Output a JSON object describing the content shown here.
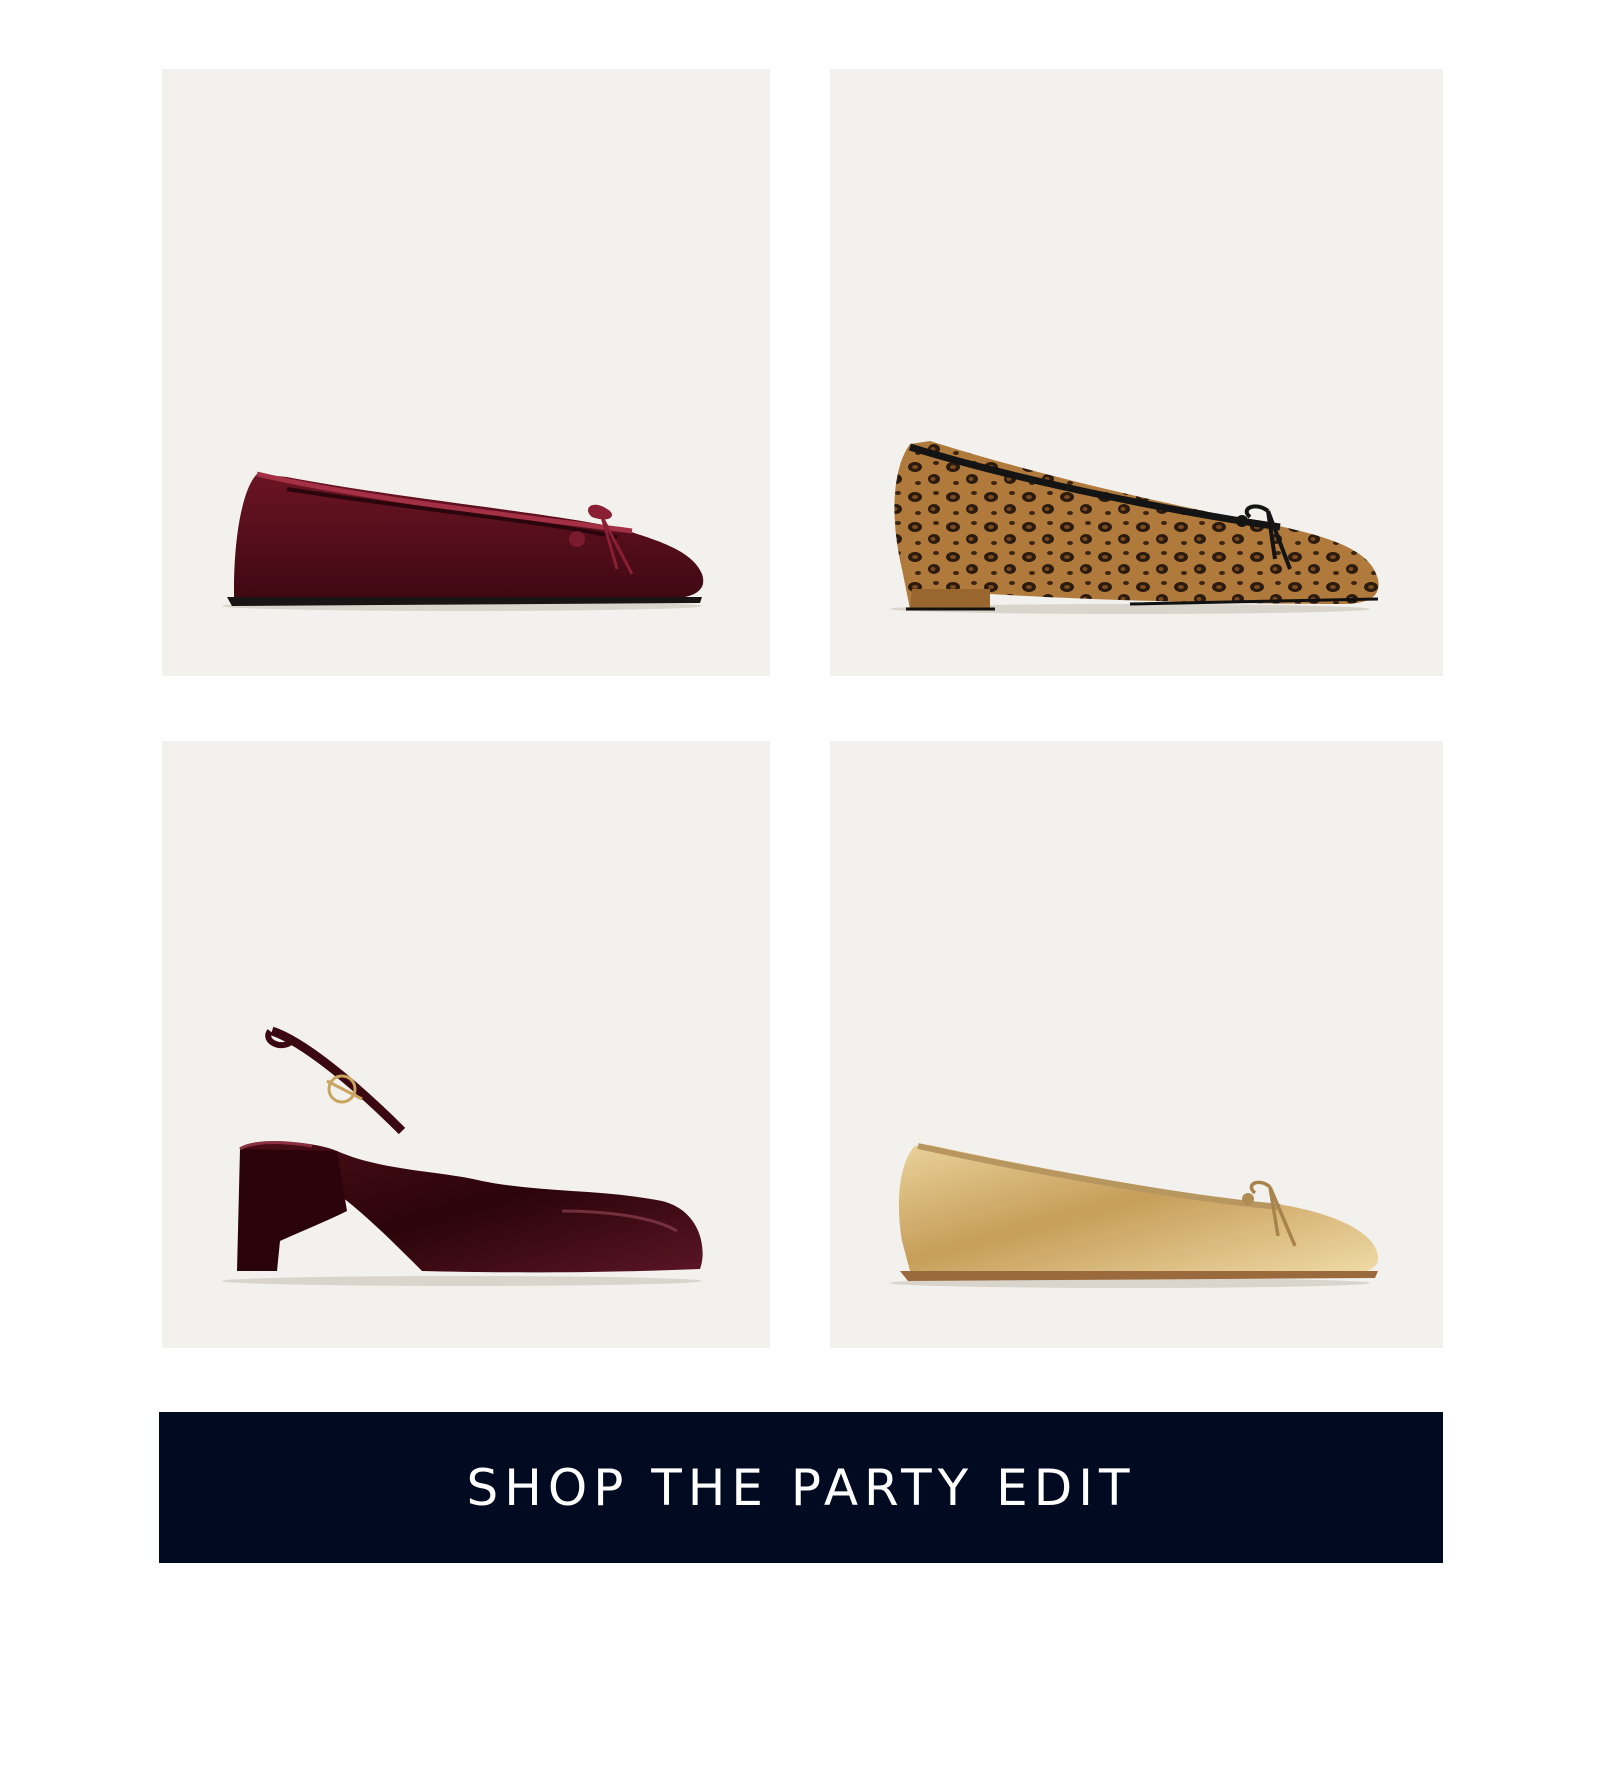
{
  "products": [
    {
      "name": "burgundy-velvet-ballet-flat",
      "icon": "burgundy-velvet-flat-image",
      "color": "#5e0f1f"
    },
    {
      "name": "leopard-print-ballet-flat",
      "icon": "leopard-block-heel-flat-image",
      "color": "#8a5a2b"
    },
    {
      "name": "burgundy-patent-slingback",
      "icon": "patent-slingback-pump-image",
      "color": "#3a0b12"
    },
    {
      "name": "gold-metallic-ballet-flat",
      "icon": "gold-ballet-flat-image",
      "color": "#c9a45e"
    }
  ],
  "cta": {
    "label": "SHOP THE PARTY EDIT",
    "background": "#000a20"
  }
}
